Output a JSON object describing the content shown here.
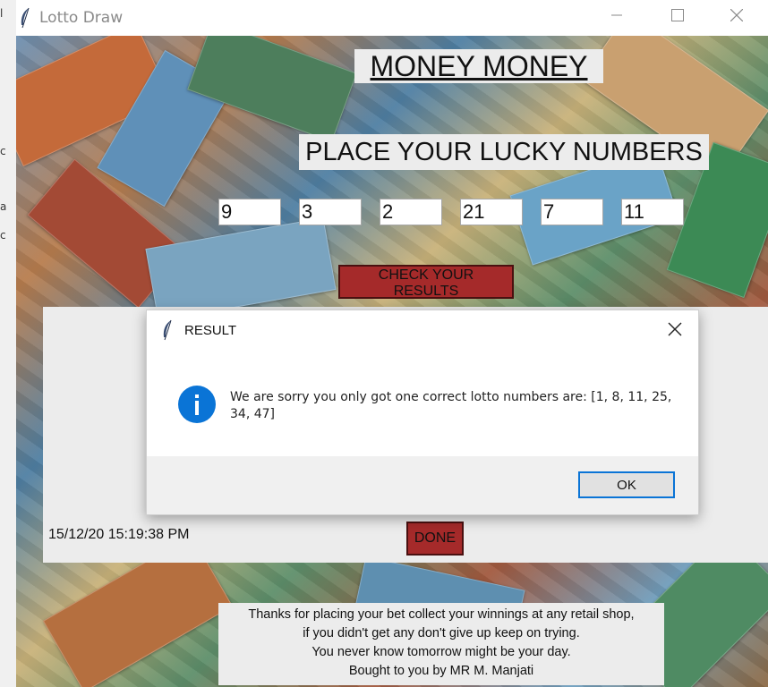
{
  "window": {
    "title": "Lotto Draw",
    "minimize_icon": "minimize-icon",
    "maximize_icon": "maximize-icon",
    "close_icon": "close-icon",
    "app_icon": "feather-icon"
  },
  "left_strip": {
    "glyphs": [
      "l",
      "c",
      "a",
      "c"
    ]
  },
  "main": {
    "title": "MONEY MONEY",
    "subtitle": "PLACE YOUR LUCKY NUMBERS",
    "numbers": [
      "9",
      "3",
      "2",
      "21",
      "7",
      "11"
    ],
    "check_button": "CHECK YOUR RESULTS",
    "background": "banknotes-collage-image"
  },
  "result_panel": {
    "timestamp": "15/12/20  15:19:38 PM",
    "done_button": "DONE"
  },
  "footer": {
    "line1": "Thanks for placing your bet collect your winnings at any retail shop,",
    "line2": "if you didn't get any don't give up keep on trying.",
    "line3": "You never know tomorrow might be your day.",
    "line4": "Bought to you by MR M. Manjati"
  },
  "dialog": {
    "title": "RESULT",
    "icon": "info-icon",
    "message": "We are sorry you only got one correct lotto numbers are: [1, 8, 11, 25, 34, 47]",
    "ok_button": "OK"
  },
  "colors": {
    "button_red": "#a52a2a",
    "label_bg": "#ececec",
    "info_blue": "#0a74d6",
    "ok_border": "#0a74d6"
  }
}
